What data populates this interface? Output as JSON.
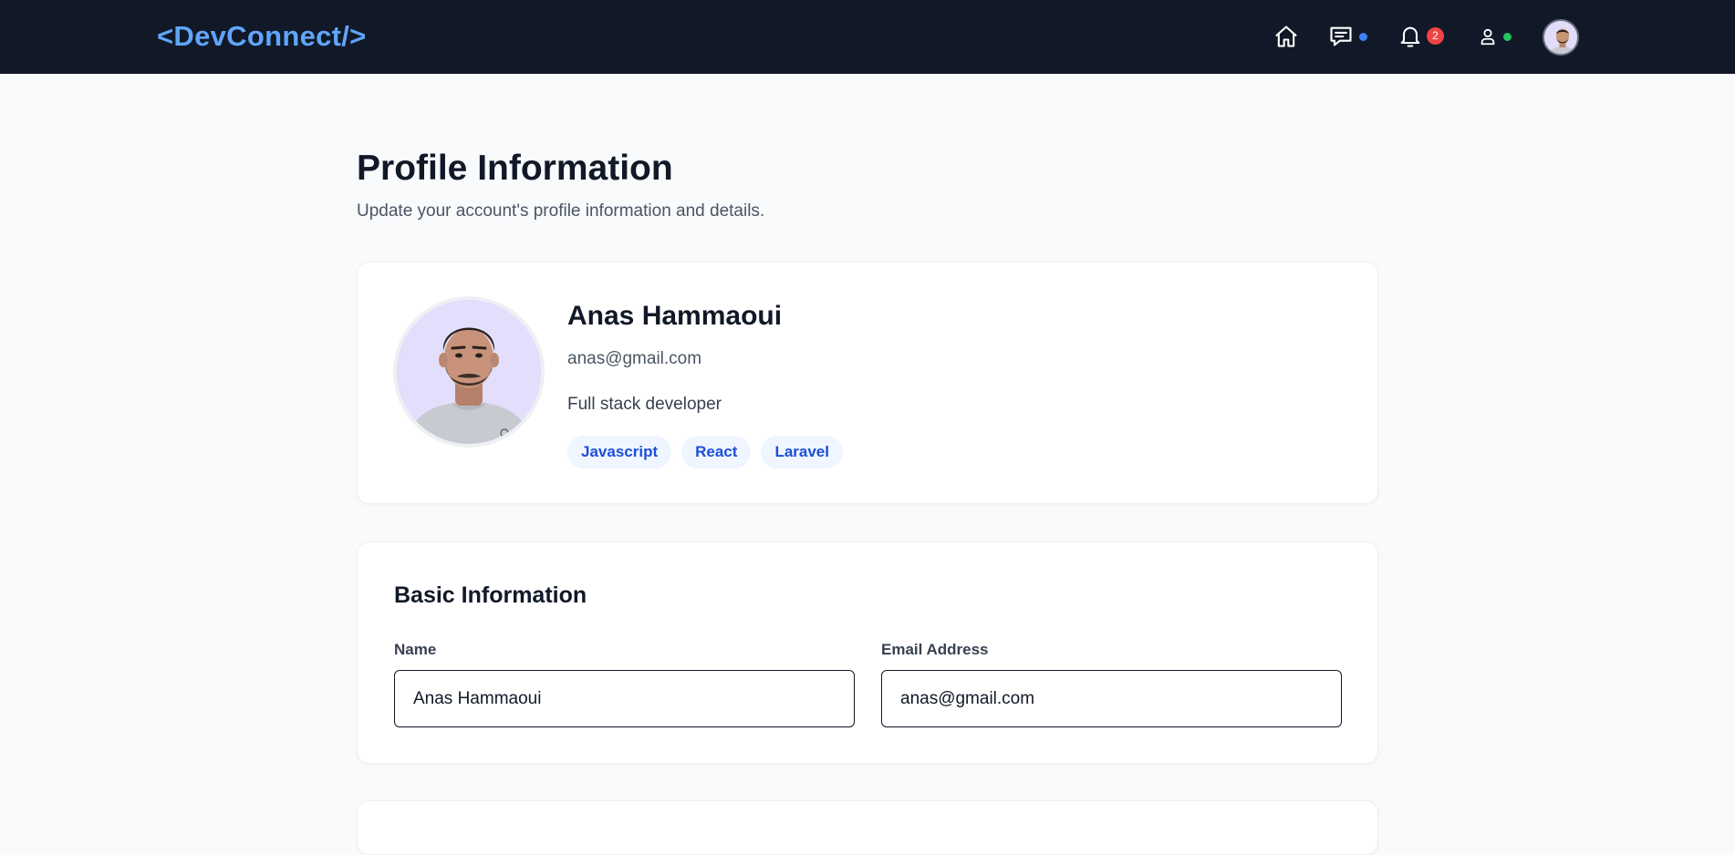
{
  "header": {
    "logo": "<DevConnect/>",
    "notifications_count": "2",
    "colors": {
      "bg": "#111827",
      "accent": "#60a5fa",
      "messages_dot": "#3b82f6",
      "online_dot": "#22c55e",
      "badge": "#ef4444"
    },
    "icons": [
      "home-icon",
      "messages-icon",
      "bell-icon",
      "user-icon",
      "avatar"
    ]
  },
  "page": {
    "title": "Profile Information",
    "subtitle": "Update your account's profile information and details."
  },
  "profile": {
    "name": "Anas Hammaoui",
    "email": "anas@gmail.com",
    "bio": "Full stack developer",
    "skills": [
      "Javascript",
      "React",
      "Laravel"
    ]
  },
  "basic_info": {
    "title": "Basic Information",
    "name_label": "Name",
    "name_value": "Anas Hammaoui",
    "email_label": "Email Address",
    "email_value": "anas@gmail.com"
  }
}
